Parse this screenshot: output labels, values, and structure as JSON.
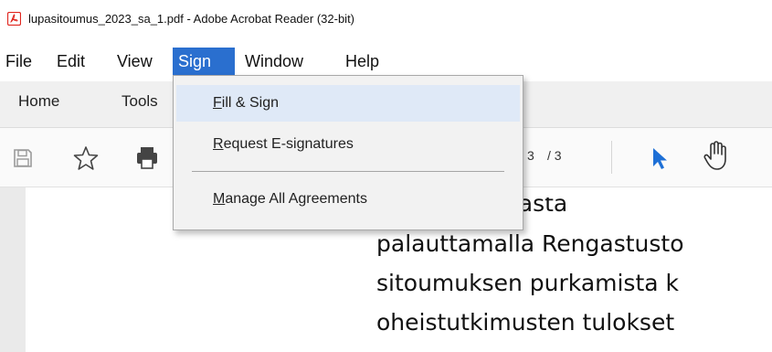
{
  "window": {
    "title": "lupasitoumus_2023_sa_1.pdf - Adobe Acrobat Reader (32-bit)",
    "app_icon": "acrobat-icon"
  },
  "menubar": {
    "items": [
      {
        "label": "File",
        "active": false
      },
      {
        "label": "Edit",
        "active": false
      },
      {
        "label": "View",
        "active": false
      },
      {
        "label": "Sign",
        "active": true
      },
      {
        "label": "Window",
        "active": false
      },
      {
        "label": "Help",
        "active": false
      }
    ]
  },
  "tabs": {
    "items": [
      {
        "label": "Home"
      },
      {
        "label": "Tools"
      }
    ]
  },
  "toolbar": {
    "icons": [
      "save-icon",
      "star-icon",
      "print-icon",
      "select-arrow-icon",
      "hand-icon"
    ],
    "page_current": "3",
    "page_total": "/ 3"
  },
  "sign_menu": {
    "items": [
      {
        "mnemonic": "F",
        "rest": "ill & Sign",
        "hovered": true
      },
      {
        "mnemonic": "R",
        "rest": "equest E-signatures",
        "hovered": false
      },
      {
        "mnemonic": "M",
        "rest": "anage All Agreements",
        "hovered": false
      }
    ]
  },
  "document": {
    "lines": [
      "ua käyttöluvasta",
      "palauttamalla Rengastusto",
      "sitoumuksen purkamista k",
      "oheistutkimusten tulokset"
    ]
  },
  "colors": {
    "accent": "#2a6fcf",
    "menu_hover": "#dfe9f7",
    "pointer_blue": "#1d6fd6",
    "acrobat_red": "#e0261f"
  }
}
